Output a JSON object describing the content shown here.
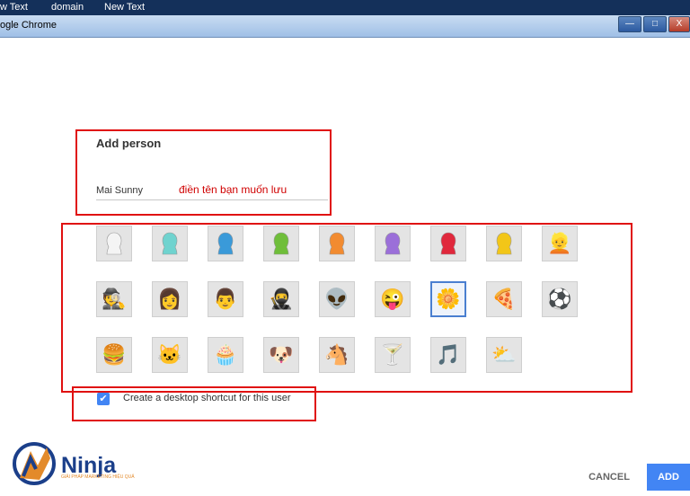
{
  "taskbar": {
    "items": [
      "w Text",
      "domain",
      "New Text"
    ]
  },
  "window": {
    "title": "ogle Chrome",
    "minimize": "—",
    "maximize": "□",
    "close": "X"
  },
  "dialog": {
    "title": "Add person",
    "name_value": "Mai Sunny",
    "annotation": "điền tên bạn muốn lưu",
    "avatars": [
      {
        "name": "avatar-white",
        "glyph": "👤",
        "color": "#f4f4f4"
      },
      {
        "name": "avatar-cyan",
        "glyph": "👤",
        "color": "#6fd3cf"
      },
      {
        "name": "avatar-blue",
        "glyph": "👤",
        "color": "#3a9ad9"
      },
      {
        "name": "avatar-green",
        "glyph": "👤",
        "color": "#6fbe3a"
      },
      {
        "name": "avatar-orange",
        "glyph": "👤",
        "color": "#f28b30"
      },
      {
        "name": "avatar-purple",
        "glyph": "👤",
        "color": "#9b6fd9"
      },
      {
        "name": "avatar-red",
        "glyph": "👤",
        "color": "#e0283c"
      },
      {
        "name": "avatar-yellow",
        "glyph": "👤",
        "color": "#f2c618"
      },
      {
        "name": "avatar-blonde",
        "glyph": "👱",
        "color": null
      },
      {
        "name": "avatar-businessman",
        "glyph": "🕵",
        "color": null
      },
      {
        "name": "avatar-sunglasses-woman",
        "glyph": "👩",
        "color": null
      },
      {
        "name": "avatar-man",
        "glyph": "👨",
        "color": null
      },
      {
        "name": "avatar-ninja",
        "glyph": "🥷",
        "color": null
      },
      {
        "name": "avatar-alien",
        "glyph": "👽",
        "color": null
      },
      {
        "name": "avatar-smiley",
        "glyph": "😜",
        "color": null
      },
      {
        "name": "avatar-flower",
        "glyph": "🌼",
        "color": null
      },
      {
        "name": "avatar-pizza",
        "glyph": "🍕",
        "color": null
      },
      {
        "name": "avatar-soccer",
        "glyph": "⚽",
        "color": null
      },
      {
        "name": "avatar-burger",
        "glyph": "🍔",
        "color": null
      },
      {
        "name": "avatar-cat",
        "glyph": "🐱",
        "color": null
      },
      {
        "name": "avatar-cupcake",
        "glyph": "🧁",
        "color": null
      },
      {
        "name": "avatar-dog",
        "glyph": "🐶",
        "color": null
      },
      {
        "name": "avatar-horse",
        "glyph": "🐴",
        "color": null
      },
      {
        "name": "avatar-cocktail",
        "glyph": "🍸",
        "color": null
      },
      {
        "name": "avatar-music",
        "glyph": "🎵",
        "color": null
      },
      {
        "name": "avatar-sun-cloud",
        "glyph": "⛅",
        "color": null
      }
    ],
    "selected_avatar_index": 15,
    "shortcut_checked": true,
    "shortcut_check_mark": "✔",
    "shortcut_label": "Create a desktop shortcut for this user",
    "cancel_label": "CANCEL",
    "add_label": "ADD"
  },
  "logo": {
    "text": "Ninja",
    "tagline": "GIẢI PHÁP MARKETING HIỆU QUẢ"
  },
  "colors": {
    "accent": "#4285f4",
    "highlight_box": "#e01010",
    "annotation_text": "#d00000"
  }
}
